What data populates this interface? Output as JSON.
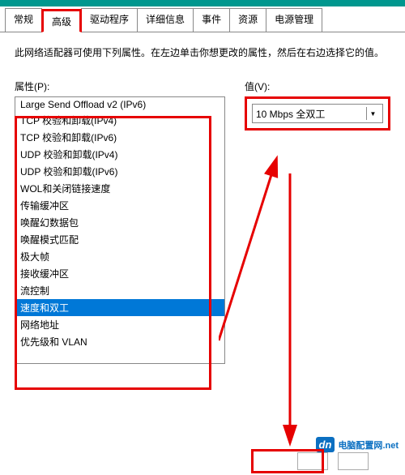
{
  "tabs": {
    "items": [
      {
        "label": "常规"
      },
      {
        "label": "高级"
      },
      {
        "label": "驱动程序"
      },
      {
        "label": "详细信息"
      },
      {
        "label": "事件"
      },
      {
        "label": "资源"
      },
      {
        "label": "电源管理"
      }
    ],
    "active_index": 1
  },
  "description": "此网络适配器可使用下列属性。在左边单击你想更改的属性，然后在右边选择它的值。",
  "property": {
    "label": "属性(P):",
    "items": [
      "Large Send Offload v2 (IPv6)",
      "TCP 校验和卸载(IPv4)",
      "TCP 校验和卸载(IPv6)",
      "UDP 校验和卸载(IPv4)",
      "UDP 校验和卸载(IPv6)",
      "WOL和关闭链接速度",
      "传输缓冲区",
      "唤醒幻数据包",
      "唤醒模式匹配",
      "极大帧",
      "接收缓冲区",
      "流控制",
      "速度和双工",
      "网络地址",
      "优先级和 VLAN"
    ],
    "selected_index": 12
  },
  "value": {
    "label": "值(V):",
    "selected": "10 Mbps 全双工"
  },
  "watermark": {
    "logo": "dn",
    "text_a": "电脑配置网",
    "text_b": ".net"
  },
  "annotation": {
    "color": "#e60000"
  }
}
